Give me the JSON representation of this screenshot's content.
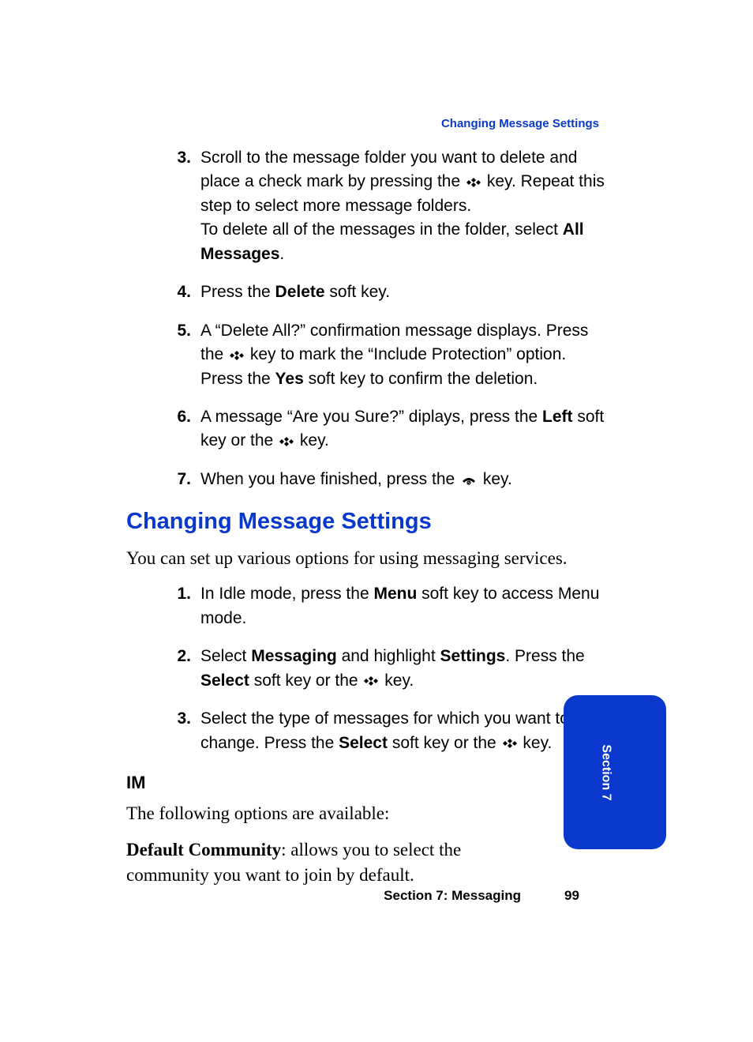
{
  "running_head": "Changing Message Settings",
  "list_a": {
    "items": [
      {
        "num": "3.",
        "segments": [
          {
            "t": "text",
            "v": "Scroll to the message folder you want to delete and place a check mark by pressing the "
          },
          {
            "t": "icon",
            "v": "ok-key"
          },
          {
            "t": "text",
            "v": " key. Repeat this step to select more message folders."
          },
          {
            "t": "br"
          },
          {
            "t": "text",
            "v": "To delete all of the messages in the folder, select "
          },
          {
            "t": "bold",
            "v": "All Messages"
          },
          {
            "t": "text",
            "v": "."
          }
        ]
      },
      {
        "num": "4.",
        "segments": [
          {
            "t": "text",
            "v": "Press the "
          },
          {
            "t": "bold",
            "v": "Delete"
          },
          {
            "t": "text",
            "v": " soft key."
          }
        ]
      },
      {
        "num": "5.",
        "segments": [
          {
            "t": "text",
            "v": "A “Delete All?” confirmation message displays. Press the "
          },
          {
            "t": "icon",
            "v": "ok-key"
          },
          {
            "t": "text",
            "v": " key to mark the “Include Protection” option. Press the "
          },
          {
            "t": "bold",
            "v": "Yes"
          },
          {
            "t": "text",
            "v": " soft key to confirm the deletion."
          }
        ]
      },
      {
        "num": "6.",
        "segments": [
          {
            "t": "text",
            "v": "A message “Are you Sure?” diplays, press the "
          },
          {
            "t": "bold",
            "v": "Left"
          },
          {
            "t": "text",
            "v": " soft key or the  "
          },
          {
            "t": "icon",
            "v": "ok-key"
          },
          {
            "t": "text",
            "v": " key."
          }
        ]
      },
      {
        "num": "7.",
        "segments": [
          {
            "t": "text",
            "v": "When you have finished, press the "
          },
          {
            "t": "icon",
            "v": "end-key"
          },
          {
            "t": "text",
            "v": " key."
          }
        ]
      }
    ]
  },
  "heading": "Changing Message Settings",
  "intro": "You can set up various options for using messaging services.",
  "list_b": {
    "items": [
      {
        "num": "1.",
        "segments": [
          {
            "t": "text",
            "v": "In Idle mode, press the "
          },
          {
            "t": "bold",
            "v": "Menu"
          },
          {
            "t": "text",
            "v": " soft key to access Menu mode."
          }
        ]
      },
      {
        "num": "2.",
        "segments": [
          {
            "t": "text",
            "v": "Select "
          },
          {
            "t": "bold",
            "v": "Messaging"
          },
          {
            "t": "text",
            "v": " and highlight "
          },
          {
            "t": "bold",
            "v": "Settings"
          },
          {
            "t": "text",
            "v": ". Press the "
          },
          {
            "t": "bold",
            "v": "Select"
          },
          {
            "t": "text",
            "v": " soft key or the "
          },
          {
            "t": "icon",
            "v": "ok-key"
          },
          {
            "t": "text",
            "v": " key."
          }
        ]
      },
      {
        "num": "3.",
        "segments": [
          {
            "t": "text",
            "v": "Select the type of messages for which you want to change. Press the "
          },
          {
            "t": "bold",
            "v": "Select"
          },
          {
            "t": "text",
            "v": " soft key or the "
          },
          {
            "t": "icon",
            "v": "ok-key"
          },
          {
            "t": "text",
            "v": " key."
          }
        ]
      }
    ]
  },
  "sub_heading": "IM",
  "im_intro": "The following options are available:",
  "im_option": {
    "label": "Default Community",
    "desc": ": allows you to select the community you want to join by default."
  },
  "side_tab": "Section 7",
  "footer_title": "Section 7: Messaging",
  "footer_page": "99"
}
